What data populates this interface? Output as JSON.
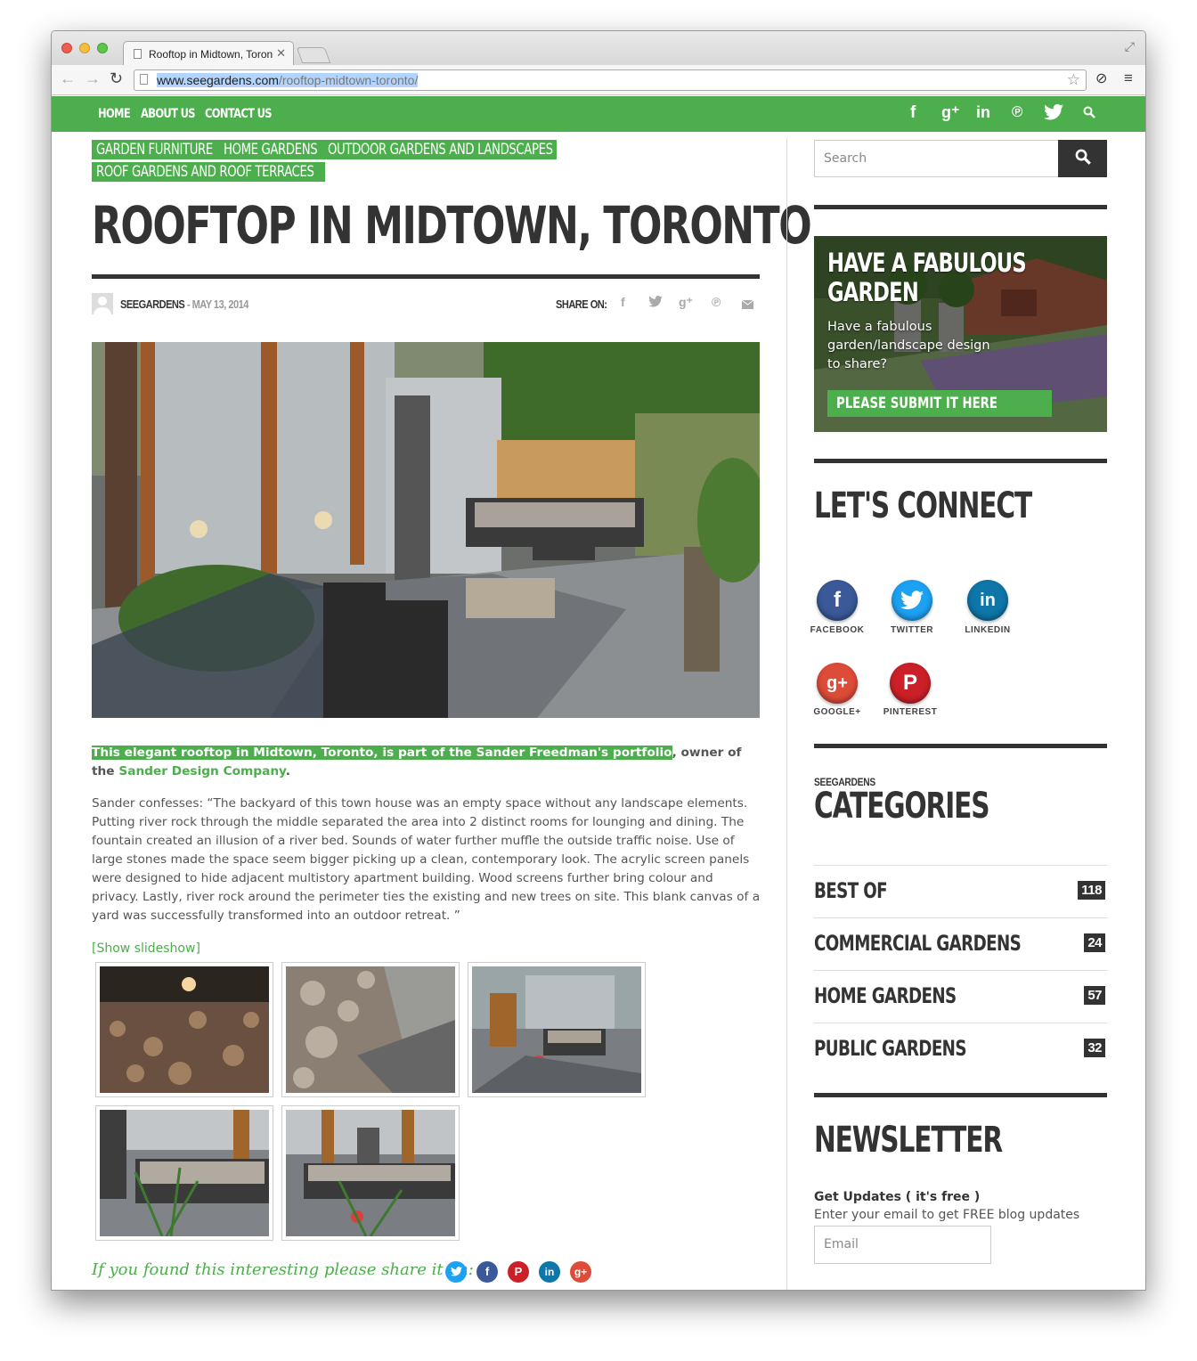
{
  "browser": {
    "tab_title": "Rooftop in Midtown, Toron",
    "url_host": "www.seegardens.com",
    "url_path": "/rooftop-midtown-toronto/"
  },
  "nav": {
    "links": [
      "HOME",
      "ABOUT US",
      "CONTACT US"
    ],
    "social_icons": [
      "facebook-icon",
      "google-plus-icon",
      "linkedin-icon",
      "pinterest-icon",
      "twitter-icon",
      "search-icon"
    ]
  },
  "article": {
    "categories": [
      "GARDEN FURNITURE",
      "HOME GARDENS",
      "OUTDOOR GARDENS AND LANDSCAPES",
      "ROOF GARDENS AND ROOF TERRACES"
    ],
    "title": "ROOFTOP IN MIDTOWN, TORONTO",
    "author": "SEEGARDENS",
    "date": " - MAY 13, 2014",
    "share_label": "SHARE ON:",
    "intro_highlight": "This elegant rooftop in Midtown, Toronto, is part of the Sander Freedman's portfolio",
    "intro_rest": ", owner of the ",
    "intro_link": "Sander Design Company",
    "intro_end": ".",
    "body": "Sander confesses: “The backyard of this town house was an empty space without any landscape elements. Putting river rock through the middle separated the area into 2 distinct rooms for lounging and dining. The fountain created an illusion of a river bed. Sounds of water further muffle the outside traffic noise. Use of large stones made the space seem bigger picking up a clean, contemporary look. The acrylic screen panels were designed to hide adjacent multistory apartment building. Wood screens further bring colour and privacy. Lastly, river rock around the perimeter ties the existing and new trees on site. This blank canvas of a yard was successfully transformed into an outdoor retreat. ”",
    "slideshow_link": "[Show slideshow]",
    "share_bottom": "If you found this interesting please share it on:"
  },
  "sidebar": {
    "search_placeholder": "Search",
    "promo": {
      "heading": "HAVE A FABULOUS GARDEN",
      "text": "Have a fabulous garden/landscape design to share?",
      "button": "PLEASE SUBMIT IT HERE"
    },
    "connect_title": "LET'S CONNECT",
    "connect_items": [
      "FACEBOOK",
      "TWITTER",
      "LINKEDIN",
      "GOOGLE+",
      "PINTEREST"
    ],
    "categories_kicker": "SEEGARDENS",
    "categories_title": "CATEGORIES",
    "categories": [
      {
        "name": "BEST OF",
        "count": "118"
      },
      {
        "name": "COMMERCIAL GARDENS",
        "count": "24"
      },
      {
        "name": "HOME GARDENS",
        "count": "57"
      },
      {
        "name": "PUBLIC GARDENS",
        "count": "32"
      }
    ],
    "newsletter_title": "NEWSLETTER",
    "newsletter_head": "Get Updates ( it's free )",
    "newsletter_text": "Enter your email to get FREE blog updates",
    "email_placeholder": "Email"
  },
  "colors": {
    "brand_green": "#4cae4c",
    "dark": "#333333",
    "facebook": "#3b5998",
    "twitter": "#1da1f2",
    "linkedin": "#0e76a8",
    "googleplus": "#dd4b39",
    "pinterest": "#cb2027"
  }
}
